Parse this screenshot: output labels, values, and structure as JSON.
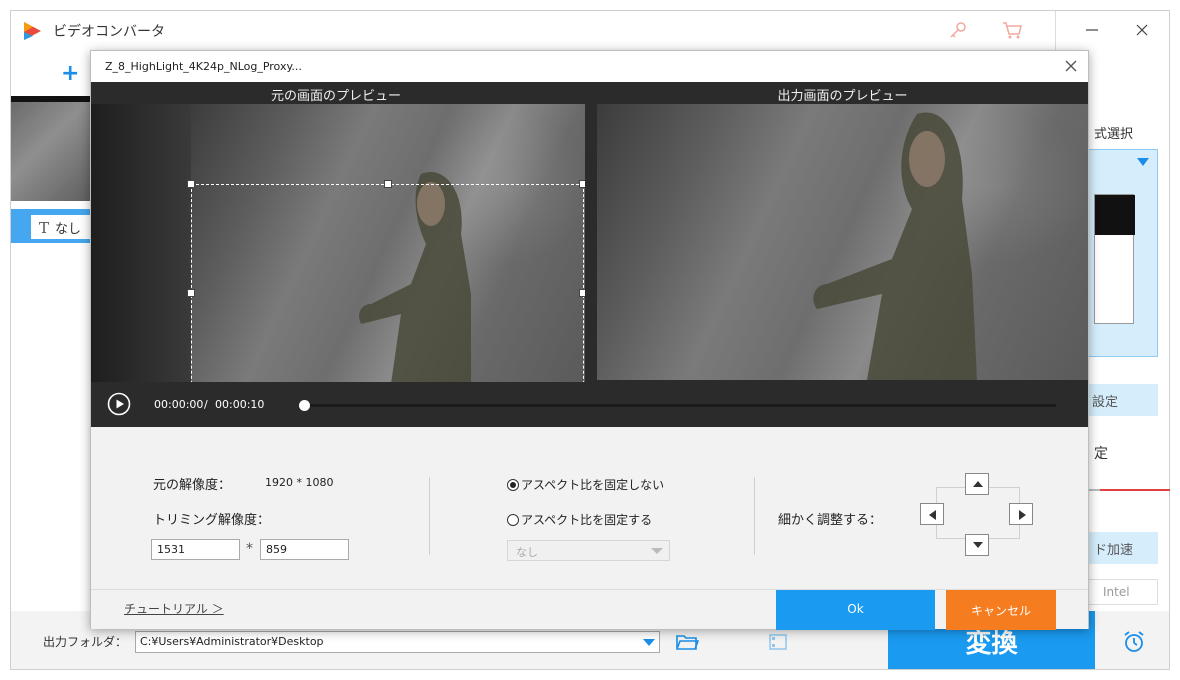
{
  "app": {
    "title": "ビデオコンバータ",
    "accent_color": "#1a9af0",
    "cancel_color": "#f57c1f"
  },
  "main": {
    "add_file_label": "+",
    "subtitle_value": "なし",
    "subtitle_icon": "T",
    "format_label_partial": "式選択",
    "settings_partial": "設定",
    "output_setting_partial": "定",
    "hw_accel_partial": "ド加速",
    "intel_label": "Intel"
  },
  "bottom": {
    "output_folder_label": "出力フォルダ：",
    "output_path": "C:¥Users¥Administrator¥Desktop",
    "convert_label": "変換"
  },
  "dialog": {
    "title": "Z_8_HighLight_4K24p_NLog_Proxy...",
    "source_preview_label": "元の画面のプレビュー",
    "output_preview_label": "出力画面のプレビュー",
    "time_current": "00:00:00",
    "time_separator": "/",
    "time_total": "00:00:10",
    "playback_progress": 0.0,
    "original_resolution_label": "元の解像度：",
    "original_resolution_value": "1920 * 1080",
    "trim_resolution_label": "トリミング解像度：",
    "trim_width": "1531",
    "trim_height": "859",
    "times_sign": "*",
    "aspect_free_label": "アスペクト比を固定しない",
    "aspect_fixed_label": "アスペクト比を固定する",
    "aspect_free_selected": true,
    "ratio_select_value": "なし",
    "fine_adjust_label": "細かく調整する：",
    "tutorial_label": "チュートリアル ＞",
    "ok_label": "Ok",
    "cancel_label": "キャンセル"
  }
}
